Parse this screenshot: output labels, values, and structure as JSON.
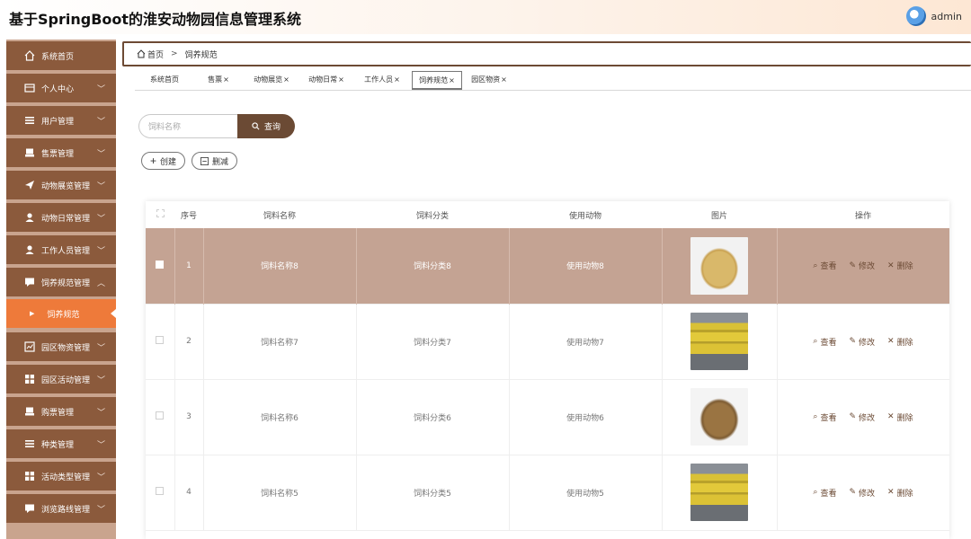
{
  "app": {
    "title": "基于SpringBoot的淮安动物园信息管理系统",
    "username": "admin"
  },
  "sidebar": {
    "items": [
      {
        "label": "系统首页",
        "icon": "home-icon",
        "has_arrow": false
      },
      {
        "label": "个人中心",
        "icon": "id-card-icon",
        "has_arrow": true
      },
      {
        "label": "用户管理",
        "icon": "menu-icon",
        "has_arrow": true
      },
      {
        "label": "售票管理",
        "icon": "ticket-icon",
        "has_arrow": true
      },
      {
        "label": "动物展览管理",
        "icon": "send-icon",
        "has_arrow": true
      },
      {
        "label": "动物日常管理",
        "icon": "user-icon",
        "has_arrow": true
      },
      {
        "label": "工作人员管理",
        "icon": "user-icon",
        "has_arrow": true
      },
      {
        "label": "饲养规范管理",
        "icon": "chat-icon",
        "has_arrow": true,
        "expanded": true
      },
      {
        "label": "园区物资管理",
        "icon": "chart-icon",
        "has_arrow": true
      },
      {
        "label": "园区活动管理",
        "icon": "grid-icon",
        "has_arrow": true
      },
      {
        "label": "购票管理",
        "icon": "ticket-icon",
        "has_arrow": true
      },
      {
        "label": "种类管理",
        "icon": "menu-icon",
        "has_arrow": true
      },
      {
        "label": "活动类型管理",
        "icon": "grid-icon",
        "has_arrow": true
      },
      {
        "label": "浏览路线管理",
        "icon": "chat-icon",
        "has_arrow": true
      }
    ],
    "active_sub": "饲养规范"
  },
  "breadcrumb": {
    "home": "首页",
    "separator": ">",
    "current": "饲养规范"
  },
  "tabs": [
    {
      "label": "系统首页",
      "closable": false
    },
    {
      "label": "售票",
      "closable": true
    },
    {
      "label": "动物展览",
      "closable": true
    },
    {
      "label": "动物日常",
      "closable": true
    },
    {
      "label": "工作人员",
      "closable": true
    },
    {
      "label": "饲养规范",
      "closable": true,
      "active": true
    },
    {
      "label": "园区物资",
      "closable": true
    }
  ],
  "search": {
    "placeholder": "饲料名称",
    "button_label": "查询"
  },
  "toolbar": {
    "create_label": "创建",
    "delete_label": "删减"
  },
  "table": {
    "columns": [
      "序号",
      "饲料名称",
      "饲料分类",
      "使用动物",
      "图片",
      "操作"
    ],
    "actions": {
      "view": "查看",
      "edit": "修改",
      "delete": "删除"
    },
    "rows": [
      {
        "index": "1",
        "name": "饲料名称8",
        "category": "饲料分类8",
        "animal": "使用动物8",
        "image": "grain-pile-light",
        "selected": true
      },
      {
        "index": "2",
        "name": "饲料名称7",
        "category": "饲料分类7",
        "animal": "使用动物7",
        "image": "yellow-sacks",
        "selected": false
      },
      {
        "index": "3",
        "name": "饲料名称6",
        "category": "饲料分类6",
        "animal": "使用动物6",
        "image": "grain-pile-dark",
        "selected": false
      },
      {
        "index": "4",
        "name": "饲料名称5",
        "category": "饲料分类5",
        "animal": "使用动物5",
        "image": "yellow-sacks",
        "selected": false
      }
    ]
  },
  "colors": {
    "sidebar_item": "#8b5a3c",
    "sidebar_active": "#ee7a3a",
    "accent": "#6b4a34",
    "selected_row": "#c4a393"
  }
}
